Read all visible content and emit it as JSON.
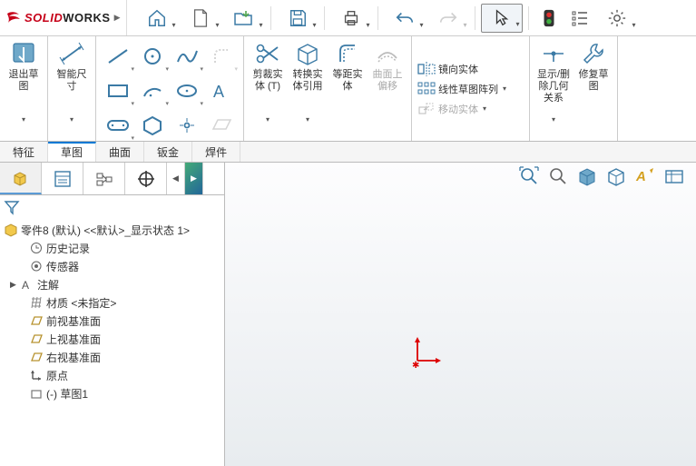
{
  "app": {
    "brand_solid": "SOLID",
    "brand_works": "WORKS"
  },
  "ribbon": {
    "exit_sketch": "退出草\n图",
    "smart_dim": "智能尺\n寸",
    "trim": "剪裁实\n体 (T)",
    "convert": "转换实\n体引用",
    "offset": "等距实\n体",
    "surface_offset": "曲面上\n偏移",
    "mirror": "镜向实体",
    "linear_pattern": "线性草图阵列",
    "move": "移动实体",
    "show_rel": "显示/删\n除几何\n关系",
    "repair": "修复草\n图"
  },
  "tabs": {
    "t1": "特征",
    "t2": "草图",
    "t3": "曲面",
    "t4": "钣金",
    "t5": "焊件"
  },
  "tree": {
    "root": "零件8 (默认) <<默认>_显示状态 1>",
    "history": "历史记录",
    "sensor": "传感器",
    "annot": "注解",
    "material": "材质 <未指定>",
    "plane1": "前视基准面",
    "plane2": "上视基准面",
    "plane3": "右视基准面",
    "origin": "原点",
    "sketch": "(-) 草图1"
  }
}
